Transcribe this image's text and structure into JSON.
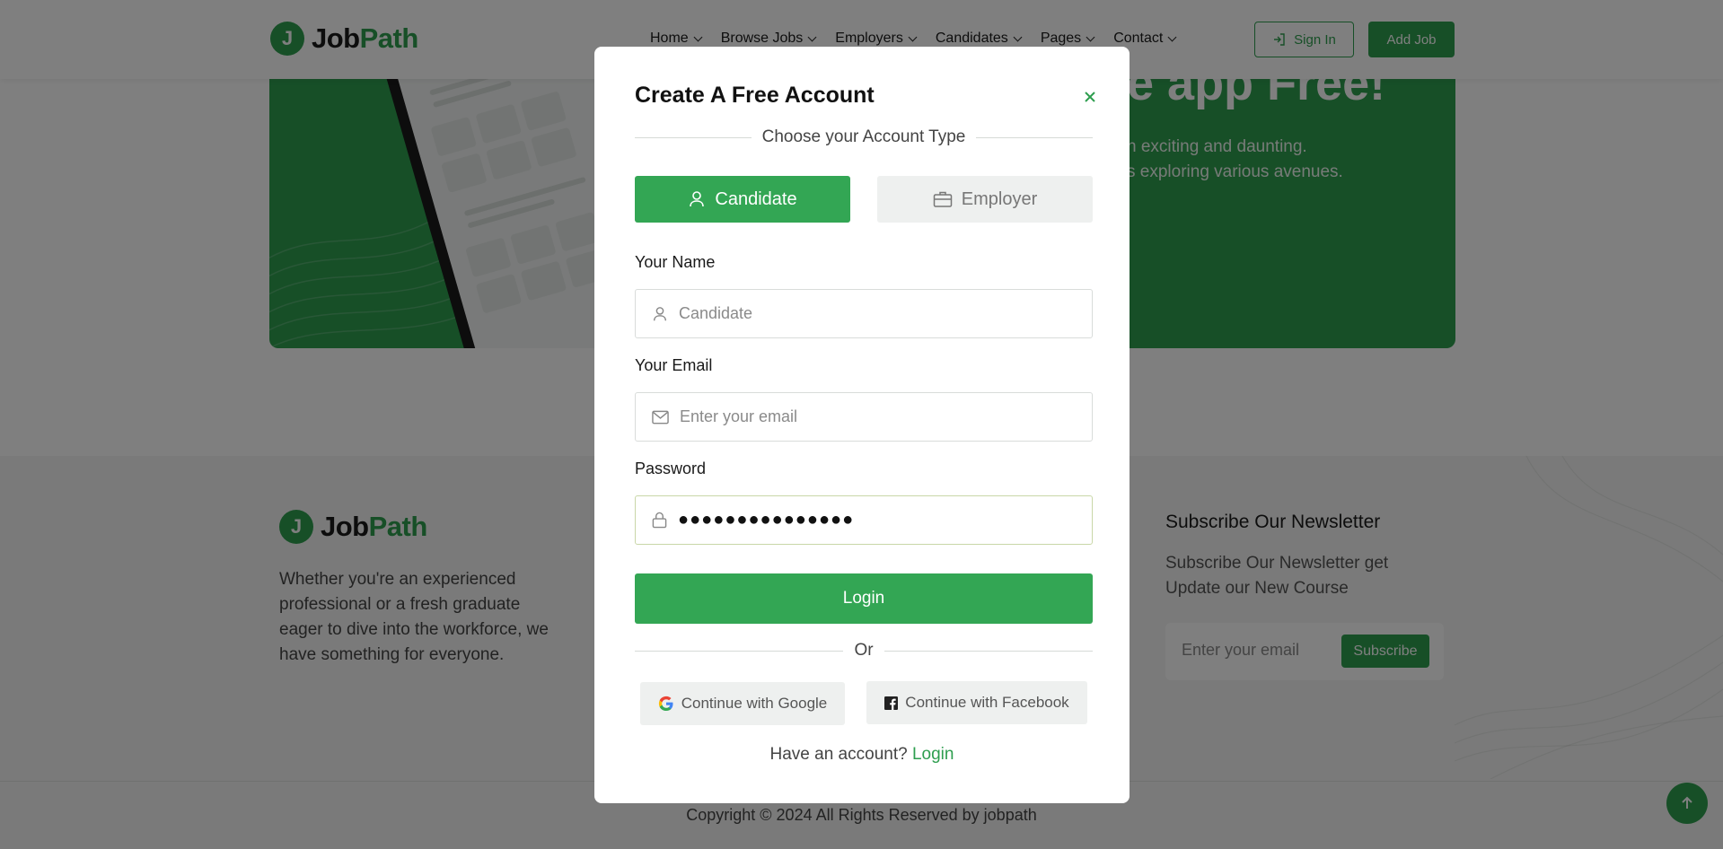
{
  "brand": {
    "logo_letter": "J",
    "name_part1": "Job",
    "name_part2": "Path",
    "accent_color": "#2e9e4f"
  },
  "header": {
    "nav": [
      {
        "label": "Home"
      },
      {
        "label": "Browse Jobs"
      },
      {
        "label": "Employers"
      },
      {
        "label": "Candidates"
      },
      {
        "label": "Pages"
      },
      {
        "label": "Contact"
      }
    ],
    "sign_in_label": "Sign In",
    "add_job_label": "Add Job"
  },
  "banner": {
    "title_visible": "e app Free!",
    "text_line1": "n exciting and daunting.",
    "text_line2": "s exploring various avenues."
  },
  "footer": {
    "description": "Whether you're an experienced professional or a fresh graduate eager to dive into the workforce, we have something for everyone.",
    "newsletter_title": "Subscribe Our Newsletter",
    "newsletter_desc": "Subscribe Our Newsletter get Update our New Course",
    "newsletter_placeholder": "Enter your email",
    "subscribe_label": "Subscribe",
    "copyright": "Copyright © 2024 All Rights Reserved by jobpath"
  },
  "modal": {
    "title": "Create A Free Account",
    "account_type_heading": "Choose your Account Type",
    "account_types": [
      {
        "label": "Candidate",
        "selected": true
      },
      {
        "label": "Employer",
        "selected": false
      }
    ],
    "name_label": "Your Name",
    "name_placeholder": "Candidate",
    "email_label": "Your Email",
    "email_placeholder": "Enter your email",
    "password_label": "Password",
    "password_value": "●●●●●●●●●●●●●●●",
    "login_label": "Login",
    "or_text": "Or",
    "google_label": "Continue with Google",
    "facebook_label": "Continue with Facebook",
    "have_account_text": "Have an account?",
    "have_account_link": "Login"
  }
}
